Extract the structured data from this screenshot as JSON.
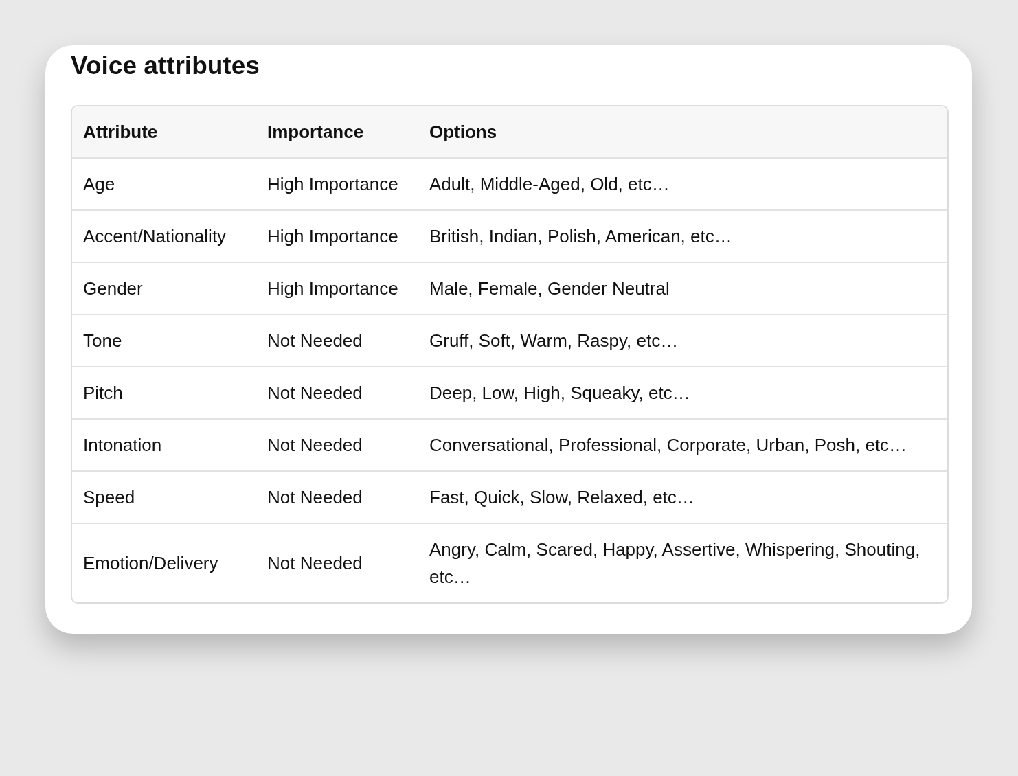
{
  "title": "Voice attributes",
  "table": {
    "columns": [
      "Attribute",
      "Importance",
      "Options"
    ],
    "rows": [
      [
        "Age",
        "High Importance",
        "Adult, Middle-Aged, Old, etc…"
      ],
      [
        "Accent/Nationality",
        "High Importance",
        "British, Indian, Polish, American, etc…"
      ],
      [
        "Gender",
        "High Importance",
        "Male, Female, Gender Neutral"
      ],
      [
        "Tone",
        "Not Needed",
        "Gruff, Soft, Warm, Raspy, etc…"
      ],
      [
        "Pitch",
        "Not Needed",
        "Deep, Low, High, Squeaky, etc…"
      ],
      [
        "Intonation",
        "Not Needed",
        "Conversational, Professional, Corporate, Urban, Posh, etc…"
      ],
      [
        "Speed",
        "Not Needed",
        "Fast, Quick, Slow, Relaxed, etc…"
      ],
      [
        "Emotion/Delivery",
        "Not Needed",
        "Angry, Calm, Scared, Happy, Assertive, Whispering, Shouting, etc…"
      ]
    ]
  }
}
